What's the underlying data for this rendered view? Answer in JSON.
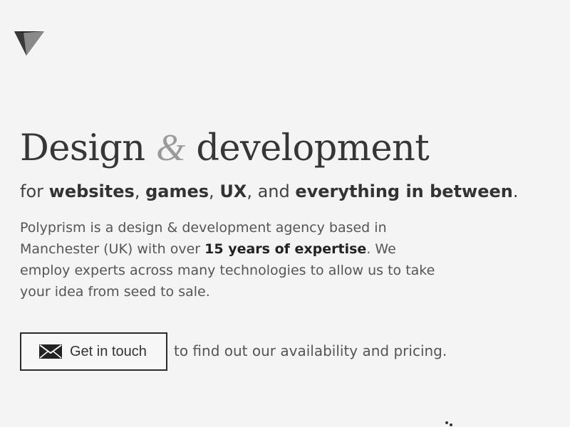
{
  "headline": {
    "word1": "Design",
    "ampersand": "&",
    "word2": "development"
  },
  "tagline": {
    "prefix": "for ",
    "item1": "websites",
    "sep1": ", ",
    "item2": "games",
    "sep2": ", ",
    "item3": "UX",
    "sep3": ", and ",
    "item4": "everything in between",
    "suffix": "."
  },
  "intro": {
    "part1": "Polyprism is a design & development agency based in Manchester (UK) with over ",
    "highlight": "15 years of expertise",
    "part2": ". We employ experts across many technologies to allow us to take your idea from seed to sale."
  },
  "cta": {
    "button_label": "Get in touch",
    "after_text": "to find out our availability and pricing."
  },
  "icons": {
    "logo": "polyprism-logo-icon",
    "contact": "envelope-icon",
    "loader": "loading-dots-icon"
  },
  "colors": {
    "background": "#f4f4f4",
    "text": "#444444",
    "accent": "#9a9a9a",
    "button_border": "#2b2b2b"
  }
}
